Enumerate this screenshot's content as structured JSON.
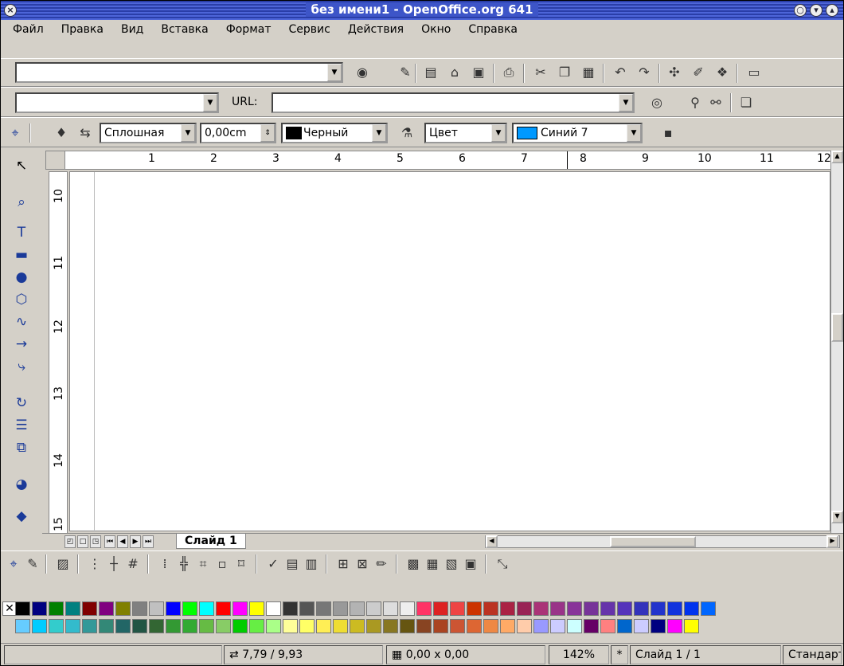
{
  "window": {
    "title": "без имени1 - OpenOffice.org 641",
    "close_glyph": "×",
    "control_glyphs": [
      "○",
      "▾",
      "▴"
    ]
  },
  "menu": {
    "items": [
      "Файл",
      "Правка",
      "Вид",
      "Вставка",
      "Формат",
      "Сервис",
      "Действия",
      "Окно",
      "Справка"
    ]
  },
  "function_bar": {
    "command_value": "",
    "icons": [
      "stop-icon",
      "edit-file-icon",
      "new-icon",
      "open-icon",
      "save-icon",
      "print-icon",
      "cut-icon",
      "copy-icon",
      "paste-icon",
      "undo-icon",
      "redo-icon",
      "navigator-icon",
      "stylist-icon",
      "gallery-icon",
      "slide-show-icon"
    ]
  },
  "hyperlink_bar": {
    "name_value": "",
    "url_label": "URL:",
    "url_value": ""
  },
  "object_bar": {
    "line_style": "Сплошная",
    "line_width": "0,00cm",
    "line_color": "Черный",
    "line_color_hex": "#000000",
    "area_style": "Цвет",
    "area_color": "Синий 7",
    "area_color_hex": "#0099ff"
  },
  "ruler": {
    "horizontal_marks": [
      "1",
      "2",
      "3",
      "4",
      "5",
      "6",
      "7",
      "8",
      "9",
      "10",
      "11",
      "12"
    ],
    "vertical_marks": [
      "10",
      "11",
      "12",
      "13",
      "14",
      "15"
    ]
  },
  "tabs": {
    "active_slide": "Слайд 1"
  },
  "palette": {
    "row1": [
      "#000000",
      "#000080",
      "#008000",
      "#008080",
      "#800000",
      "#800080",
      "#808000",
      "#808080",
      "#c0c0c0",
      "#0000ff",
      "#00ff00",
      "#00ffff",
      "#ff0000",
      "#ff00ff",
      "#ffff00",
      "#ffffff",
      "#333333",
      "#555555",
      "#777777",
      "#999999",
      "#b3b3b3",
      "#cccccc",
      "#dddddd",
      "#eeeeee",
      "#ff3366",
      "#dd2222",
      "#ee4444",
      "#cc3300",
      "#bb3322",
      "#aa2244",
      "#992255",
      "#aa3377",
      "#993388",
      "#883399",
      "#773399",
      "#6633aa",
      "#5533bb",
      "#3333bb",
      "#2233cc",
      "#1133dd",
      "#0033ee",
      "#0066ff"
    ],
    "row2": [
      "#66ccff",
      "#00ccff",
      "#33cccc",
      "#33bbcc",
      "#339999",
      "#338877",
      "#226666",
      "#225544",
      "#336633",
      "#339933",
      "#33aa33",
      "#66bb44",
      "#88cc66",
      "#00cc00",
      "#66ee44",
      "#aaff88",
      "#ffff99",
      "#ffff66",
      "#ffee55",
      "#eedd33",
      "#ccbb22",
      "#aa9922",
      "#887722",
      "#665511",
      "#884422",
      "#aa4422",
      "#cc5533",
      "#dd6633",
      "#ee8844",
      "#ffaa66",
      "#ffccaa",
      "#9999ff",
      "#ccccff",
      "#ccffff",
      "#660066",
      "#ff8080",
      "#0066cc",
      "#ccccff",
      "#000080",
      "#ff00ff",
      "#ffff00"
    ]
  },
  "status": {
    "position": "7,79 / 9,93",
    "size": "0,00 x 0,00",
    "zoom": "142%",
    "modified": "*",
    "slide": "Слайд 1 / 1",
    "layout": "Стандарт"
  }
}
